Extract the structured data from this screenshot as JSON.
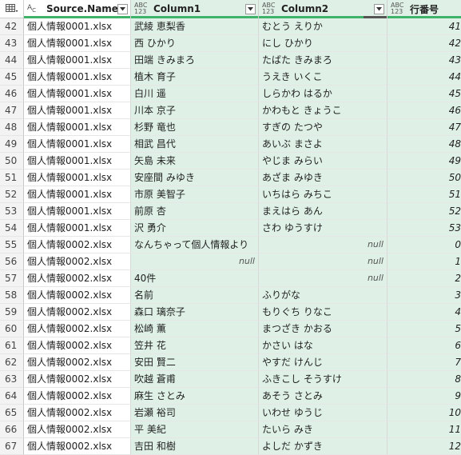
{
  "columns": [
    {
      "name": "Source.Name",
      "type": "text-type-icon",
      "type_label_top": "A",
      "type_label_bot": "C"
    },
    {
      "name": "Column1",
      "type": "any-type-icon",
      "type_label_top": "ABC",
      "type_label_bot": "123"
    },
    {
      "name": "Column2",
      "type": "any-type-icon",
      "type_label_top": "ABC",
      "type_label_bot": "123"
    },
    {
      "name": "行番号",
      "type": "any-type-icon",
      "type_label_top": "ABC",
      "type_label_bot": "123"
    }
  ],
  "rows": [
    {
      "n": "42",
      "src": "個人情報0001.xlsx",
      "c1": "武綾 恵梨香",
      "c2": "むとう えりか",
      "c3": "41"
    },
    {
      "n": "43",
      "src": "個人情報0001.xlsx",
      "c1": "西 ひかり",
      "c2": "にし ひかり",
      "c3": "42"
    },
    {
      "n": "44",
      "src": "個人情報0001.xlsx",
      "c1": "田端 きみまろ",
      "c2": "たばた きみまろ",
      "c3": "43"
    },
    {
      "n": "45",
      "src": "個人情報0001.xlsx",
      "c1": "植木 育子",
      "c2": "うえき いくこ",
      "c3": "44"
    },
    {
      "n": "46",
      "src": "個人情報0001.xlsx",
      "c1": "白川 遥",
      "c2": "しらかわ はるか",
      "c3": "45"
    },
    {
      "n": "47",
      "src": "個人情報0001.xlsx",
      "c1": "川本 京子",
      "c2": "かわもと きょうこ",
      "c3": "46"
    },
    {
      "n": "48",
      "src": "個人情報0001.xlsx",
      "c1": "杉野 竜也",
      "c2": "すぎの たつや",
      "c3": "47"
    },
    {
      "n": "49",
      "src": "個人情報0001.xlsx",
      "c1": "相武 昌代",
      "c2": "あいぶ まさよ",
      "c3": "48"
    },
    {
      "n": "50",
      "src": "個人情報0001.xlsx",
      "c1": "矢島 未来",
      "c2": "やじま みらい",
      "c3": "49"
    },
    {
      "n": "51",
      "src": "個人情報0001.xlsx",
      "c1": "安座間 みゆき",
      "c2": "あざま みゆき",
      "c3": "50"
    },
    {
      "n": "52",
      "src": "個人情報0001.xlsx",
      "c1": "市原 美智子",
      "c2": "いちはら みちこ",
      "c3": "51"
    },
    {
      "n": "53",
      "src": "個人情報0001.xlsx",
      "c1": "前原 杏",
      "c2": "まえはら あん",
      "c3": "52"
    },
    {
      "n": "54",
      "src": "個人情報0001.xlsx",
      "c1": "沢 勇介",
      "c2": "さわ ゆうすけ",
      "c3": "53"
    },
    {
      "n": "55",
      "src": "個人情報0002.xlsx",
      "c1": "なんちゃって個人情報より",
      "c2": "null",
      "c3": "0"
    },
    {
      "n": "56",
      "src": "個人情報0002.xlsx",
      "c1": "null",
      "c2": "null",
      "c3": "1"
    },
    {
      "n": "57",
      "src": "個人情報0002.xlsx",
      "c1": "40件",
      "c2": "null",
      "c3": "2"
    },
    {
      "n": "58",
      "src": "個人情報0002.xlsx",
      "c1": "名前",
      "c2": "ふりがな",
      "c3": "3"
    },
    {
      "n": "59",
      "src": "個人情報0002.xlsx",
      "c1": "森口 璃奈子",
      "c2": "もりぐち りなこ",
      "c3": "4"
    },
    {
      "n": "60",
      "src": "個人情報0002.xlsx",
      "c1": "松崎 薫",
      "c2": "まつざき かおる",
      "c3": "5"
    },
    {
      "n": "61",
      "src": "個人情報0002.xlsx",
      "c1": "笠井 花",
      "c2": "かさい はな",
      "c3": "6"
    },
    {
      "n": "62",
      "src": "個人情報0002.xlsx",
      "c1": "安田 賢二",
      "c2": "やすだ けんじ",
      "c3": "7"
    },
    {
      "n": "63",
      "src": "個人情報0002.xlsx",
      "c1": "吹越 蒼甫",
      "c2": "ふきこし そうすけ",
      "c3": "8"
    },
    {
      "n": "64",
      "src": "個人情報0002.xlsx",
      "c1": "麻生 さとみ",
      "c2": "あそう さとみ",
      "c3": "9"
    },
    {
      "n": "65",
      "src": "個人情報0002.xlsx",
      "c1": "岩瀬 裕司",
      "c2": "いわせ ゆうじ",
      "c3": "10"
    },
    {
      "n": "66",
      "src": "個人情報0002.xlsx",
      "c1": "平 美紀",
      "c2": "たいら みき",
      "c3": "11"
    },
    {
      "n": "67",
      "src": "個人情報0002.xlsx",
      "c1": "吉田 和樹",
      "c2": "よしだ かずき",
      "c3": "12"
    }
  ],
  "colors": {
    "loaded_column_bg": "#dff1e6",
    "quality_valid": "#3fb36a",
    "quality_empty": "#555555",
    "row_number_bg": "#f3f3f3"
  }
}
